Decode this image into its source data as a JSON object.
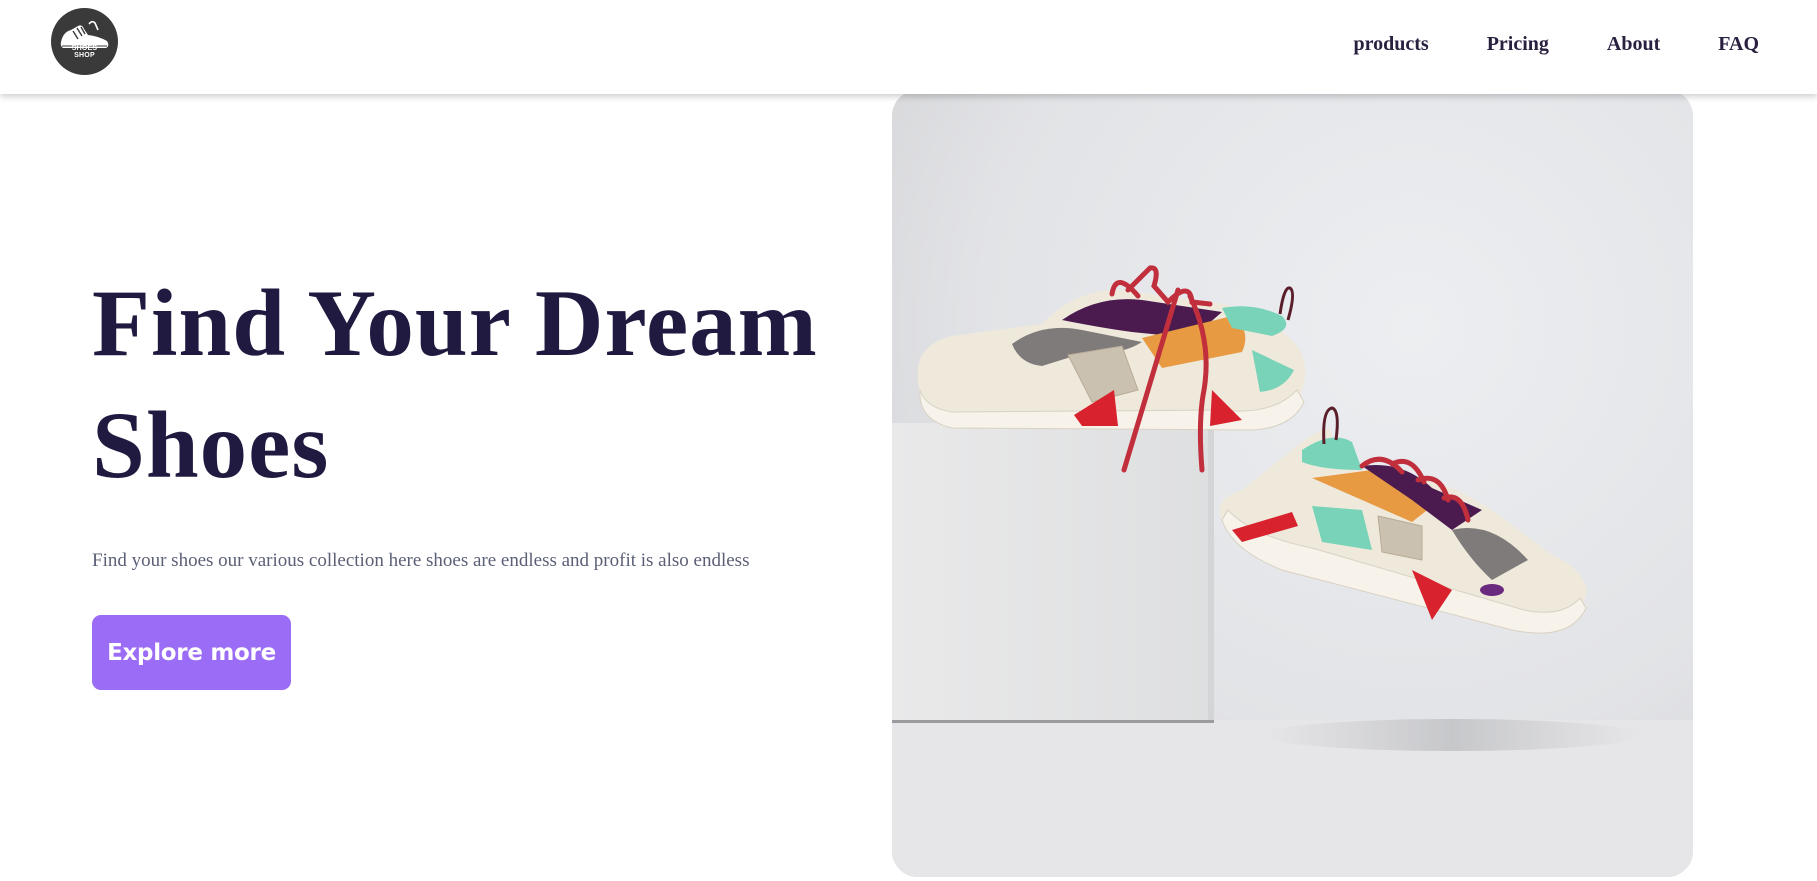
{
  "navbar": {
    "logo": {
      "text_line1": "SHOES",
      "text_line2": "SHOP",
      "icon": "sneaker-icon"
    },
    "links": [
      {
        "label": "products"
      },
      {
        "label": "Pricing"
      },
      {
        "label": "About"
      },
      {
        "label": "FAQ"
      }
    ]
  },
  "hero": {
    "title": "Find Your Dream Shoes",
    "subtitle": "Find your shoes our various collection here shoes are endless and profit is also endless",
    "cta_label": "Explore more",
    "image_alt": "Two colorful sneakers with red laces, one resting on a white box and one tilted on the floor"
  },
  "colors": {
    "title": "#211a40",
    "nav_text": "#2a2040",
    "subtitle": "#5b5f76",
    "cta_background": "#9b6cf5",
    "cta_text": "#ffffff",
    "logo_background": "#3a3a3a"
  }
}
